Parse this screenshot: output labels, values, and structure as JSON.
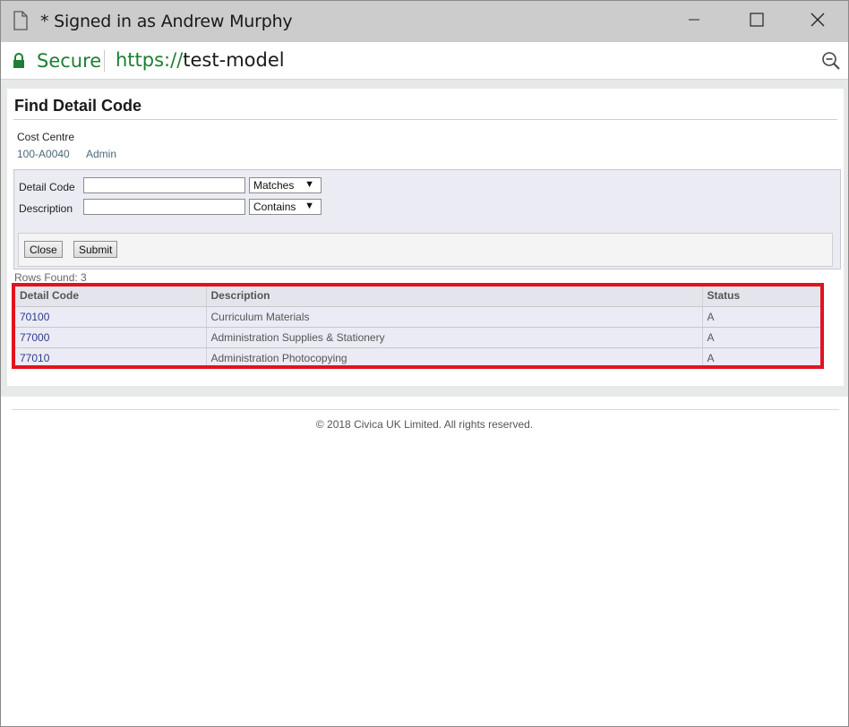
{
  "window": {
    "title": "* Signed in as Andrew Murphy",
    "icons": {
      "document": "document-icon",
      "minimize": "minimize-icon",
      "maximize": "maximize-icon",
      "close": "close-icon"
    }
  },
  "address_bar": {
    "secure_label": "Secure",
    "url_scheme": "https://",
    "url_host": "test-model",
    "secure_color": "#1e7e34",
    "icons": {
      "lock": "lock-icon",
      "zoom": "zoom-out-icon"
    }
  },
  "page": {
    "title": "Find Detail Code",
    "cost_centre": {
      "label": "Cost Centre",
      "code": "100-A0040",
      "name": "Admin"
    },
    "search": {
      "detail_code_label": "Detail Code",
      "detail_code_value": "",
      "detail_code_operator": "Matches",
      "description_label": "Description",
      "description_value": "",
      "description_operator": "Contains",
      "close_label": "Close",
      "submit_label": "Submit"
    },
    "rows_found": "Rows Found: 3",
    "table": {
      "headers": [
        "Detail Code",
        "Description",
        "Status"
      ],
      "rows": [
        {
          "code": "70100",
          "description": "Curriculum Materials",
          "status": "A"
        },
        {
          "code": "77000",
          "description": "Administration Supplies & Stationery",
          "status": "A"
        },
        {
          "code": "77010",
          "description": "Administration Photocopying",
          "status": "A"
        }
      ]
    },
    "highlight_color": "#e0141e",
    "footer": "© 2018 Civica UK Limited. All rights reserved."
  }
}
